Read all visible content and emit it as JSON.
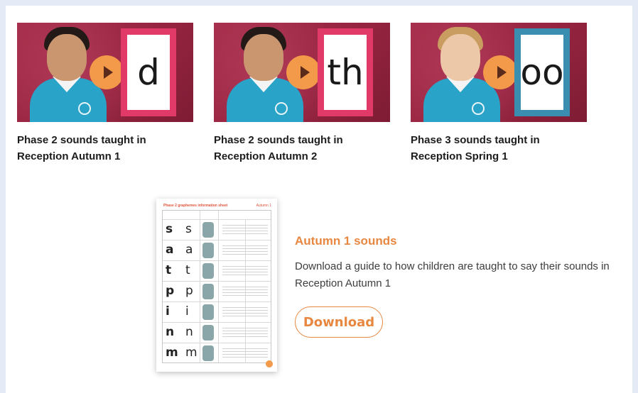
{
  "videos": [
    {
      "grapheme": "d",
      "title": "Phase 2 sounds taught in Reception Autumn 1",
      "card_color": "#e23a68"
    },
    {
      "grapheme": "th",
      "title": "Phase 2 sounds taught in Reception Autumn 2",
      "card_color": "#e23a68"
    },
    {
      "grapheme": "oo",
      "title": "Phase 3 sounds taught in Reception Spring 1",
      "card_color": "#3a8fb0"
    }
  ],
  "document": {
    "heading": "Phase 2 graphemes information sheet",
    "term": "Autumn 1",
    "rows": [
      {
        "upper": "s",
        "lower": "s"
      },
      {
        "upper": "a",
        "lower": "a"
      },
      {
        "upper": "t",
        "lower": "t"
      },
      {
        "upper": "p",
        "lower": "p"
      },
      {
        "upper": "i",
        "lower": "i"
      },
      {
        "upper": "n",
        "lower": "n"
      },
      {
        "upper": "m",
        "lower": "m"
      }
    ]
  },
  "resource": {
    "title": "Autumn 1 sounds",
    "description": "Download a guide to how children are taught to say their sounds in Reception Autumn 1",
    "button_label": "Download"
  },
  "colors": {
    "accent": "#e8873f",
    "play": "#f2994a",
    "thumb_bg": "#a8304e",
    "sweater": "#2aa3c8"
  }
}
